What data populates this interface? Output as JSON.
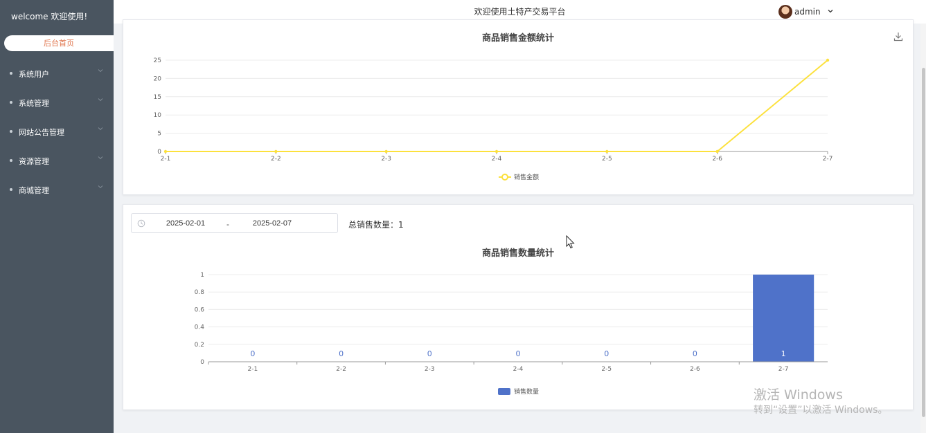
{
  "sidebar": {
    "welcome": "welcome 欢迎使用!",
    "home": "后台首页",
    "items": [
      {
        "label": "系统用户"
      },
      {
        "label": "系统管理"
      },
      {
        "label": "网站公告管理"
      },
      {
        "label": "资源管理"
      },
      {
        "label": "商城管理"
      }
    ]
  },
  "header": {
    "title": "欢迎使用土特产交易平台",
    "user": "admin"
  },
  "filter": {
    "start_date": "2025-02-01",
    "separator": "-",
    "end_date": "2025-02-07",
    "total_label": "总销售数量：",
    "total_value": "1"
  },
  "watermark": {
    "line1": "激活 Windows",
    "line2": "转到“设置”以激活 Windows。"
  },
  "colors": {
    "sidebar_bg": "#4a5560",
    "line_color": "#fce13d",
    "bar_color": "#4f72c9",
    "home_text": "#e0764e"
  },
  "chart_data": [
    {
      "type": "line",
      "title": "商品销售金额统计",
      "categories": [
        "2-1",
        "2-2",
        "2-3",
        "2-4",
        "2-5",
        "2-6",
        "2-7"
      ],
      "series": [
        {
          "name": "销售金额",
          "values": [
            0,
            0,
            0,
            0,
            0,
            0,
            25
          ]
        }
      ],
      "ylim": [
        0,
        25
      ],
      "yticks": [
        0,
        5,
        10,
        15,
        20,
        25
      ],
      "legend": "bottom-center",
      "grid": true
    },
    {
      "type": "bar",
      "title": "商品销售数量统计",
      "categories": [
        "2-1",
        "2-2",
        "2-3",
        "2-4",
        "2-5",
        "2-6",
        "2-7"
      ],
      "series": [
        {
          "name": "销售数量",
          "values": [
            0,
            0,
            0,
            0,
            0,
            0,
            1
          ]
        }
      ],
      "ylim": [
        0,
        1
      ],
      "yticks": [
        "0",
        "0.2",
        "0.4",
        "0.6",
        "0.8",
        "1"
      ],
      "legend": "bottom-center",
      "grid": true,
      "data_labels": true
    }
  ]
}
